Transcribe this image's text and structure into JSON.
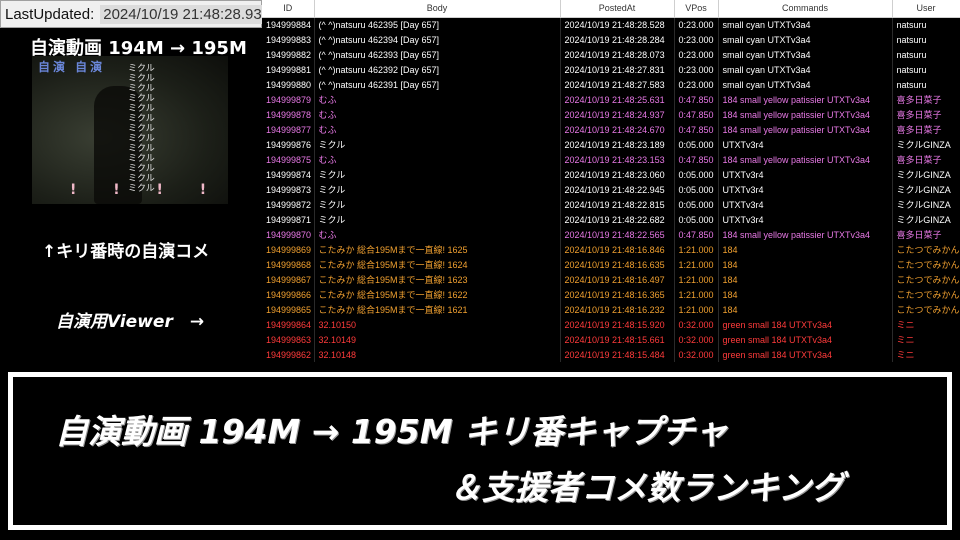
{
  "last_updated": {
    "label": "LastUpdated:",
    "value": "2024/10/19 21:48:28.939"
  },
  "left_panel": {
    "title": "自演動画 194M → 195M",
    "thumbnail": {
      "top_text": "自演 自演",
      "v_comments": "ミクル\nミクル\nミクル\nミクル\nミクル\nミクル\nミクル\nミクル\nミクル\nミクル\nミクル\nミクル\nミクル",
      "bottom_marks": "! ! ! !"
    },
    "caption_kiri": "↑キリ番時の自演コメ",
    "caption_viewer": "自演用Viewer　→"
  },
  "table": {
    "columns": [
      "ID",
      "Body",
      "PostedAt",
      "VPos",
      "Commands",
      "User"
    ],
    "rows": [
      {
        "id": "194999884",
        "body": "(^ ^)natsuru 462395 [Day 657]",
        "posted": "2024/10/19 21:48:28.528",
        "vpos": "0:23.000",
        "cmd": "small cyan UTXTv3a4",
        "user": "natsuru",
        "color": "#ffffff"
      },
      {
        "id": "194999883",
        "body": "(^ ^)natsuru 462394 [Day 657]",
        "posted": "2024/10/19 21:48:28.284",
        "vpos": "0:23.000",
        "cmd": "small cyan UTXTv3a4",
        "user": "natsuru",
        "color": "#ffffff"
      },
      {
        "id": "194999882",
        "body": "(^ ^)natsuru 462393 [Day 657]",
        "posted": "2024/10/19 21:48:28.073",
        "vpos": "0:23.000",
        "cmd": "small cyan UTXTv3a4",
        "user": "natsuru",
        "color": "#ffffff"
      },
      {
        "id": "194999881",
        "body": "(^ ^)natsuru 462392 [Day 657]",
        "posted": "2024/10/19 21:48:27.831",
        "vpos": "0:23.000",
        "cmd": "small cyan UTXTv3a4",
        "user": "natsuru",
        "color": "#ffffff"
      },
      {
        "id": "194999880",
        "body": "(^ ^)natsuru 462391 [Day 657]",
        "posted": "2024/10/19 21:48:27.583",
        "vpos": "0:23.000",
        "cmd": "small cyan UTXTv3a4",
        "user": "natsuru",
        "color": "#ffffff"
      },
      {
        "id": "194999879",
        "body": "むふ",
        "posted": "2024/10/19 21:48:25.631",
        "vpos": "0:47.850",
        "cmd": "184 small yellow patissier UTXTv3a4",
        "user": "喜多日菜子",
        "color": "#e879e6"
      },
      {
        "id": "194999878",
        "body": "むふ",
        "posted": "2024/10/19 21:48:24.937",
        "vpos": "0:47.850",
        "cmd": "184 small yellow patissier UTXTv3a4",
        "user": "喜多日菜子",
        "color": "#e879e6"
      },
      {
        "id": "194999877",
        "body": "むふ",
        "posted": "2024/10/19 21:48:24.670",
        "vpos": "0:47.850",
        "cmd": "184 small yellow patissier UTXTv3a4",
        "user": "喜多日菜子",
        "color": "#e879e6"
      },
      {
        "id": "194999876",
        "body": "ミクル",
        "posted": "2024/10/19 21:48:23.189",
        "vpos": "0:05.000",
        "cmd": "UTXTv3r4",
        "user": "ミクルGINZA",
        "color": "#ffffff"
      },
      {
        "id": "194999875",
        "body": "むふ",
        "posted": "2024/10/19 21:48:23.153",
        "vpos": "0:47.850",
        "cmd": "184 small yellow patissier UTXTv3a4",
        "user": "喜多日菜子",
        "color": "#e879e6"
      },
      {
        "id": "194999874",
        "body": "ミクル",
        "posted": "2024/10/19 21:48:23.060",
        "vpos": "0:05.000",
        "cmd": "UTXTv3r4",
        "user": "ミクルGINZA",
        "color": "#ffffff"
      },
      {
        "id": "194999873",
        "body": "ミクル",
        "posted": "2024/10/19 21:48:22.945",
        "vpos": "0:05.000",
        "cmd": "UTXTv3r4",
        "user": "ミクルGINZA",
        "color": "#ffffff"
      },
      {
        "id": "194999872",
        "body": "ミクル",
        "posted": "2024/10/19 21:48:22.815",
        "vpos": "0:05.000",
        "cmd": "UTXTv3r4",
        "user": "ミクルGINZA",
        "color": "#ffffff"
      },
      {
        "id": "194999871",
        "body": "ミクル",
        "posted": "2024/10/19 21:48:22.682",
        "vpos": "0:05.000",
        "cmd": "UTXTv3r4",
        "user": "ミクルGINZA",
        "color": "#ffffff"
      },
      {
        "id": "194999870",
        "body": "むふ",
        "posted": "2024/10/19 21:48:22.565",
        "vpos": "0:47.850",
        "cmd": "184 small yellow patissier UTXTv3a4",
        "user": "喜多日菜子",
        "color": "#e879e6"
      },
      {
        "id": "194999869",
        "body": "こたみか 総合195Mまで一直線! 1625",
        "posted": "2024/10/19 21:48:16.846",
        "vpos": "1:21.000",
        "cmd": "184",
        "user": "こたつでみかん",
        "color": "#f0a030"
      },
      {
        "id": "194999868",
        "body": "こたみか 総合195Mまで一直線! 1624",
        "posted": "2024/10/19 21:48:16.635",
        "vpos": "1:21.000",
        "cmd": "184",
        "user": "こたつでみかん",
        "color": "#f0a030"
      },
      {
        "id": "194999867",
        "body": "こたみか 総合195Mまで一直線! 1623",
        "posted": "2024/10/19 21:48:16.497",
        "vpos": "1:21.000",
        "cmd": "184",
        "user": "こたつでみかん",
        "color": "#f0a030"
      },
      {
        "id": "194999866",
        "body": "こたみか 総合195Mまで一直線! 1622",
        "posted": "2024/10/19 21:48:16.365",
        "vpos": "1:21.000",
        "cmd": "184",
        "user": "こたつでみかん",
        "color": "#f0a030"
      },
      {
        "id": "194999865",
        "body": "こたみか 総合195Mまで一直線! 1621",
        "posted": "2024/10/19 21:48:16.232",
        "vpos": "1:21.000",
        "cmd": "184",
        "user": "こたつでみかん",
        "color": "#f0a030"
      },
      {
        "id": "194999864",
        "body": "32.10150",
        "posted": "2024/10/19 21:48:15.920",
        "vpos": "0:32.000",
        "cmd": "green small 184 UTXTv3a4",
        "user": "ミニ",
        "color": "#ff3b3b"
      },
      {
        "id": "194999863",
        "body": "32.10149",
        "posted": "2024/10/19 21:48:15.661",
        "vpos": "0:32.000",
        "cmd": "green small 184 UTXTv3a4",
        "user": "ミニ",
        "color": "#ff3b3b"
      },
      {
        "id": "194999862",
        "body": "32.10148",
        "posted": "2024/10/19 21:48:15.484",
        "vpos": "0:32.000",
        "cmd": "green small 184 UTXTv3a4",
        "user": "ミニ",
        "color": "#ff3b3b"
      }
    ]
  },
  "banner": {
    "line1": "自演動画 194M → 195M キリ番キャプチャ",
    "line2": "＆支援者コメ数ランキング"
  }
}
